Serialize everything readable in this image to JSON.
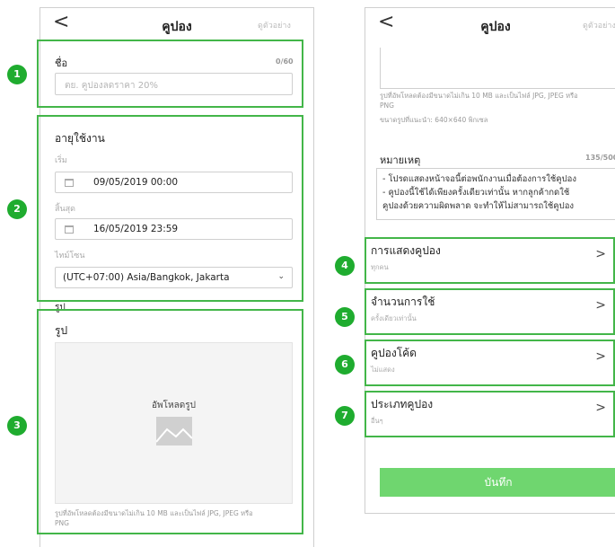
{
  "left": {
    "back": "<",
    "title": "คูปอง",
    "preview": "ดูตัวอย่าง",
    "name_label": "ชื่อ",
    "name_counter": "0/60",
    "name_placeholder": "ตย. คูปองลดราคา 20%",
    "period_title": "อายุใช้งาน",
    "start_label": "เริ่ม",
    "start_value": "09/05/2019 00:00",
    "end_label": "สิ้นสุด",
    "end_value": "16/05/2019 23:59",
    "tz_label": "ไทม์โซน",
    "tz_value": "(UTC+07:00) Asia/Bangkok, Jakarta",
    "tz_arrow": "⌄",
    "image_label_peek": "รูป",
    "image_label": "รูป",
    "upload_label": "อัพโหลดรูป",
    "upload_hint_1": "รูปที่อัพโหลดต้องมีขนาดไม่เกิน 10 MB และเป็นไฟล์ JPG, JPEG หรือ",
    "upload_hint_2": "PNG"
  },
  "right": {
    "back": "<",
    "title": "คูปอง",
    "preview": "ดูตัวอย่าง",
    "hint_1": "รูปที่อัพโหลดต้องมีขนาดไม่เกิน 10 MB และเป็นไฟล์ JPG, JPEG หรือ",
    "hint_2": "PNG",
    "hint_size": "ขนาดรูปที่แนะนำ: 640×640 พิกเซล",
    "note_label": "หมายเหตุ",
    "note_counter": "135/500",
    "note_line_1": "- โปรดแสดงหน้าจอนี้ต่อพนักงานเมื่อต้องการใช้คูปอง",
    "note_line_2": "- คูปองนี้ใช้ได้เพียงครั้งเดียวเท่านั้น หากลูกค้ากดใช้",
    "note_line_3": "คูปองด้วยความผิดพลาด จะทำให้ไม่สามารถใช้คูปอง",
    "rows": [
      {
        "title": "การแสดงคูปอง",
        "sub": "ทุกคน"
      },
      {
        "title": "จำนวนการใช้",
        "sub": "ครั้งเดียวเท่านั้น"
      },
      {
        "title": "คูปองโค้ด",
        "sub": "ไม่แสดง"
      },
      {
        "title": "ประเภทคูปอง",
        "sub": "อื่นๆ"
      }
    ],
    "chevron": ">",
    "save_label": "บันทึก"
  },
  "markers": [
    "1",
    "2",
    "3",
    "4",
    "5",
    "6",
    "7"
  ],
  "colors": {
    "annotation_green": "#43b649",
    "badge_green": "#1fac2f",
    "save_green": "#6fd66f"
  }
}
